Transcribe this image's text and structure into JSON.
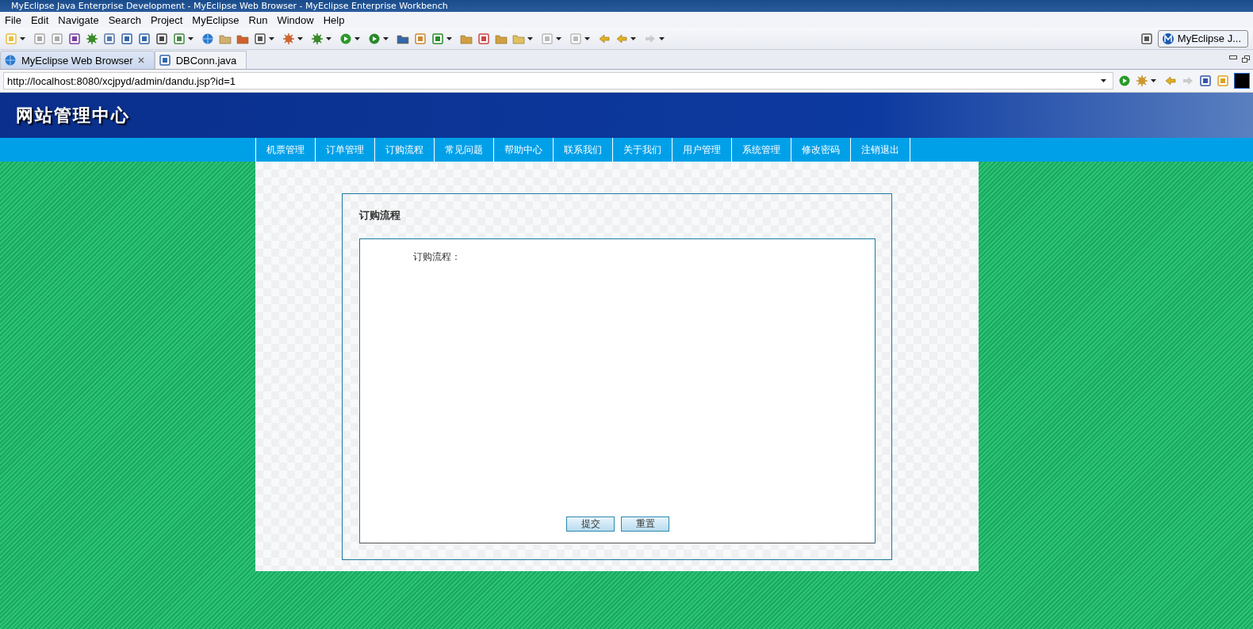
{
  "window": {
    "title": "MyEclipse Java Enterprise Development - MyEclipse Web Browser - MyEclipse Enterprise Workbench"
  },
  "menu": [
    "File",
    "Edit",
    "Navigate",
    "Search",
    "Project",
    "MyEclipse",
    "Run",
    "Window",
    "Help"
  ],
  "perspective": {
    "label": "MyEclipse J..."
  },
  "editor_tabs": [
    {
      "label": "MyEclipse Web Browser",
      "selected": true
    },
    {
      "label": "DBConn.java",
      "selected": false
    }
  ],
  "browser": {
    "url": "http://localhost:8080/xcjpyd/admin/dandu.jsp?id=1"
  },
  "site": {
    "title": "网站管理中心",
    "nav": [
      "机票管理",
      "订单管理",
      "订购流程",
      "常见问题",
      "帮助中心",
      "联系我们",
      "关于我们",
      "用户管理",
      "系统管理",
      "修改密码",
      "注销退出"
    ],
    "panel_title": "订购流程",
    "field_label": "订购流程：",
    "buttons": [
      "提交",
      "重置"
    ]
  }
}
